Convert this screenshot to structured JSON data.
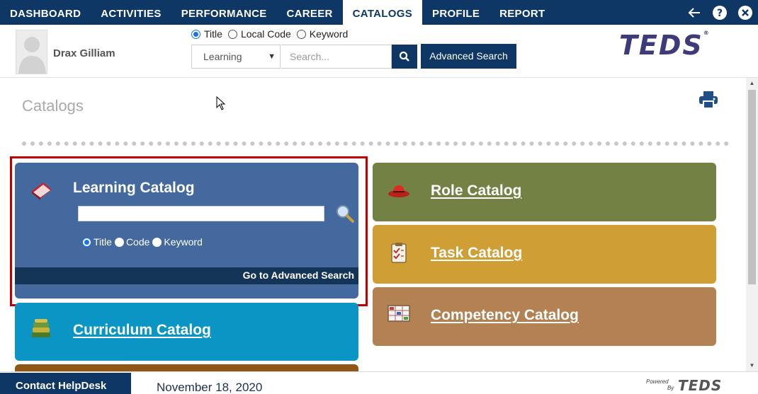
{
  "nav": {
    "items": [
      "DASHBOARD",
      "ACTIVITIES",
      "PERFORMANCE",
      "CAREER",
      "CATALOGS",
      "PROFILE",
      "REPORT"
    ],
    "active": "CATALOGS",
    "icons": [
      "back-arrow-icon",
      "help-icon",
      "close-icon"
    ]
  },
  "user": {
    "name": "Drax Gilliam"
  },
  "search": {
    "modes": [
      "Title",
      "Local Code",
      "Keyword"
    ],
    "selected_mode": "Title",
    "category": "Learning",
    "placeholder": "Search...",
    "advanced_label": "Advanced Search"
  },
  "logo": {
    "text": "TEDS",
    "mark": "®"
  },
  "page": {
    "title": "Catalogs"
  },
  "cards": {
    "learning": {
      "title": "Learning Catalog",
      "modes": [
        "Title",
        "Code",
        "Keyword"
      ],
      "selected_mode": "Title",
      "advanced_link": "Go to Advanced Search"
    },
    "curriculum": {
      "title": "Curriculum Catalog"
    },
    "role": {
      "title": "Role Catalog"
    },
    "task": {
      "title": "Task Catalog"
    },
    "competency": {
      "title": "Competency Catalog"
    }
  },
  "colors": {
    "nav": "#0e3766",
    "learning": "#43699e",
    "curriculum": "#0a95c4",
    "role": "#738244",
    "task": "#cf9f35",
    "competency": "#b38152",
    "highlight": "#c00000"
  },
  "footer": {
    "helpdesk": "Contact HelpDesk",
    "date": "November 18, 2020",
    "powered_line1": "Powered",
    "powered_line2": "By",
    "powered_logo": "TEDS"
  }
}
